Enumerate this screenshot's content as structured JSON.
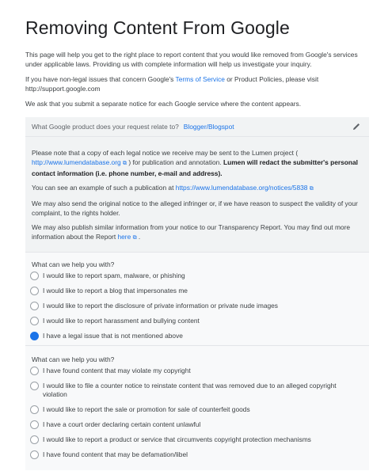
{
  "title": "Removing Content From Google",
  "intro": {
    "p1": "This page will help you get to the right place to report content that you would like removed from Google's services under applicable laws. Providing us with complete information will help us investigate your inquiry.",
    "p2_before": "If you have non-legal issues that concern Google's ",
    "p2_link": "Terms of Service",
    "p2_after": " or Product Policies, please visit http://support.google.com",
    "p3": "We ask that you submit a separate notice for each Google service where the content appears."
  },
  "product_question": {
    "label": "What Google product does your request relate to?",
    "value": "Blogger/Blogspot",
    "icon": "pencil-icon"
  },
  "notice": {
    "n1_before": "Please note that a copy of each legal notice we receive may be sent to the Lumen project ( ",
    "n1_link": "http://www.lumendatabase.org",
    "n1_mid": " ) for publication and annotation. ",
    "n1_bold": "Lumen will redact the submitter's personal contact information (i.e. phone number, e-mail and address).",
    "n2_before": "You can see an example of such a publication at ",
    "n2_link": "https://www.lumendatabase.org/notices/5838",
    "n3": "We may also send the original notice to the alleged infringer or, if we have reason to suspect the validity of your complaint, to the rights holder.",
    "n4_before": "We may also publish similar information from your notice to our Transparency Report. You may find out more information about the Report ",
    "n4_link": "here",
    "n4_after": " ."
  },
  "group1": {
    "question": "What can we help you with?",
    "options": [
      {
        "label": "I would like to report spam, malware, or phishing",
        "selected": false
      },
      {
        "label": "I would like to report a blog that impersonates me",
        "selected": false
      },
      {
        "label": "I would like to report the disclosure of private information or private nude images",
        "selected": false
      },
      {
        "label": "I would like to report harassment and bullying content",
        "selected": false
      },
      {
        "label": "I have a legal issue that is not mentioned above",
        "selected": true
      }
    ]
  },
  "group2": {
    "question": "What can we help you with?",
    "options": [
      {
        "label": "I have found content that may violate my copyright"
      },
      {
        "label": "I would like to file a counter notice to reinstate content that was removed due to an alleged copyright violation"
      },
      {
        "label": "I would like to report the sale or promotion for sale of counterfeit goods"
      },
      {
        "label": "I have a court order declaring certain content unlawful"
      },
      {
        "label": "I would like to report a product or service that circumvents copyright protection mechanisms"
      },
      {
        "label": "I have found content that may be defamation/libel"
      }
    ]
  },
  "colors": {
    "accent": "#1a73e8",
    "panel": "#f1f3f4",
    "text": "#3c4043"
  }
}
